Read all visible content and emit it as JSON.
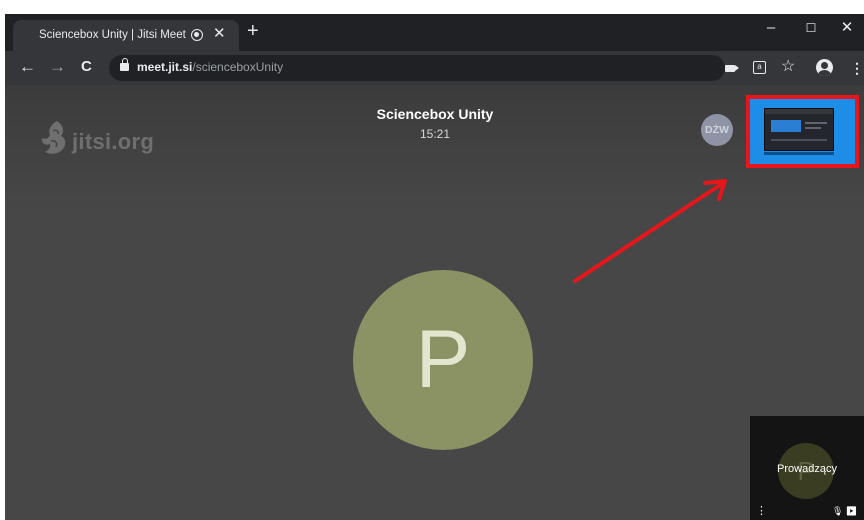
{
  "browser": {
    "tab_title": "Sciencebox Unity | Jitsi Meet",
    "tab_close": "✕",
    "new_tab": "+",
    "window": {
      "minimize": "–",
      "maximize": "☐",
      "close": "✕"
    },
    "nav": {
      "back": "←",
      "forward": "→",
      "reload": "C"
    },
    "url_host": "meet.jit.si",
    "url_path": "/scienceboxUnity",
    "star": "☆",
    "menu": "⋮"
  },
  "meeting": {
    "logo_text": "jitsi.org",
    "title": "Sciencebox Unity",
    "time": "15:21",
    "remote_initials": "DŻW",
    "speaker_initial": "P",
    "self_view": {
      "initial": "P",
      "name": "Prowadzący",
      "menu": "⋮",
      "status_icons": "🎙 ▶"
    }
  },
  "colors": {
    "annotation_red": "#e8151b",
    "avatar_green": "#8b9364",
    "meeting_bg": "#474747"
  }
}
